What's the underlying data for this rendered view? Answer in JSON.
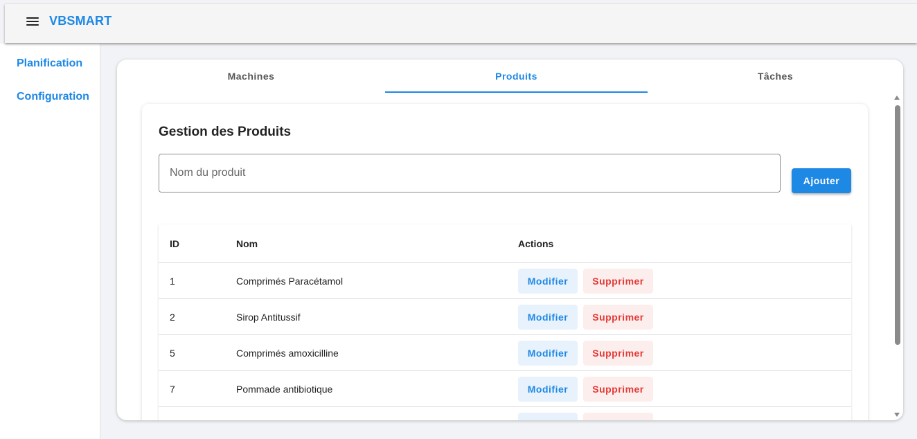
{
  "app": {
    "brand": "VBSMART"
  },
  "sidebar": {
    "items": [
      {
        "label": "Planification"
      },
      {
        "label": "Configuration"
      }
    ]
  },
  "tabs": [
    {
      "label": "Machines",
      "active": false
    },
    {
      "label": "Produits",
      "active": true
    },
    {
      "label": "Tâches",
      "active": false
    }
  ],
  "products": {
    "title": "Gestion des Produits",
    "input": {
      "placeholder": "Nom du produit",
      "value": ""
    },
    "add_label": "Ajouter",
    "table": {
      "headers": {
        "id": "ID",
        "name": "Nom",
        "actions": "Actions"
      },
      "rows": [
        {
          "id": "1",
          "name": "Comprimés Paracétamol"
        },
        {
          "id": "2",
          "name": "Sirop Antitussif"
        },
        {
          "id": "5",
          "name": "Comprimés amoxicilline"
        },
        {
          "id": "7",
          "name": "Pommade antibiotique"
        }
      ],
      "edit_label": "Modifier",
      "delete_label": "Supprimer"
    }
  },
  "colors": {
    "accent": "#1e88e5",
    "danger": "#e53935"
  }
}
